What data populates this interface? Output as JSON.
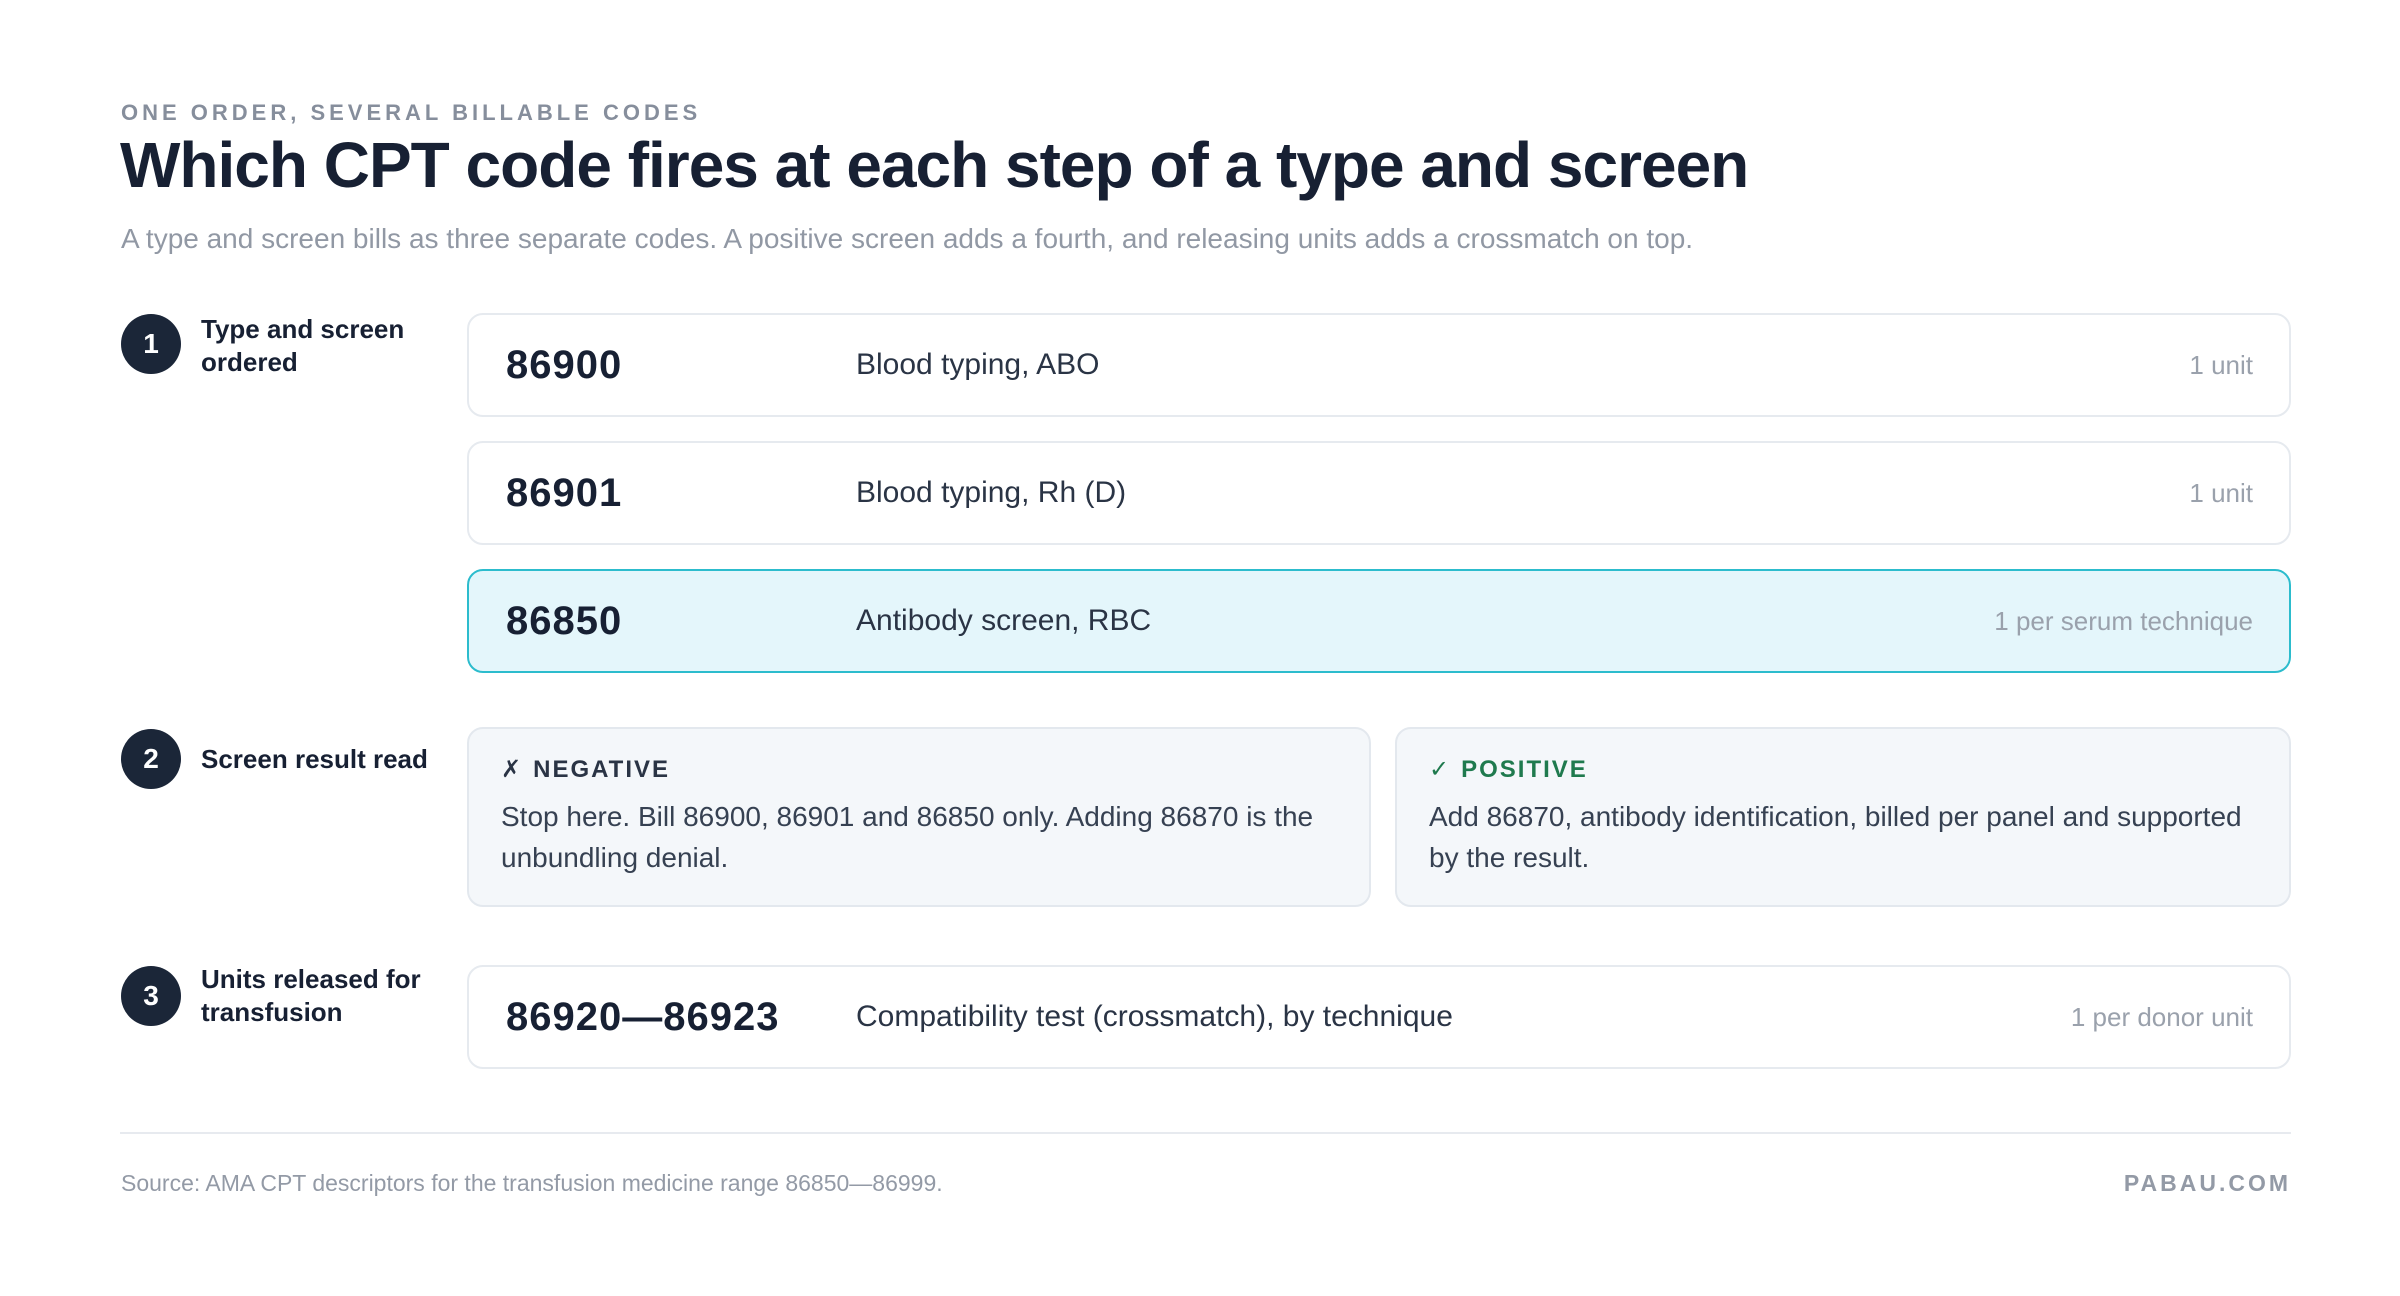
{
  "header": {
    "eyebrow": "ONE ORDER, SEVERAL BILLABLE CODES",
    "title": "Which CPT code fires at each step of a type and screen",
    "subtitle": "A type and screen bills as three separate codes. A positive screen adds a fourth, and releasing units adds a crossmatch on top."
  },
  "steps": [
    {
      "number": "1",
      "label": "Type and screen ordered",
      "codes": [
        {
          "code": "86900",
          "description": "Blood typing, ABO",
          "quantity": "1 unit"
        },
        {
          "code": "86901",
          "description": "Blood typing, Rh (D)",
          "quantity": "1 unit"
        },
        {
          "code": "86850",
          "description": "Antibody screen, RBC",
          "quantity": "1 per serum technique"
        }
      ]
    },
    {
      "number": "2",
      "label": "Screen result read",
      "outcomes": [
        {
          "icon": "✗",
          "heading": "NEGATIVE",
          "text": "Stop here. Bill 86900, 86901 and 86850 only. Adding 86870 is the unbundling denial."
        },
        {
          "icon": "✓",
          "heading": "POSITIVE",
          "text": "Add 86870, antibody identification, billed per panel and supported by the result."
        }
      ]
    },
    {
      "number": "3",
      "label": "Units released for transfusion",
      "codes": [
        {
          "code": "86920—86923",
          "description": "Compatibility test (crossmatch), by technique",
          "quantity": "1 per donor unit"
        }
      ]
    }
  ],
  "footer": {
    "source": "Source: AMA CPT descriptors for the transfusion medicine range 86850—86999.",
    "brand": "PABAU.COM"
  },
  "colors": {
    "highlight_fill": "#e4f6fb",
    "highlight_border": "#2cbccd",
    "positive": "#1f7a4e",
    "badge": "#1b2638"
  }
}
